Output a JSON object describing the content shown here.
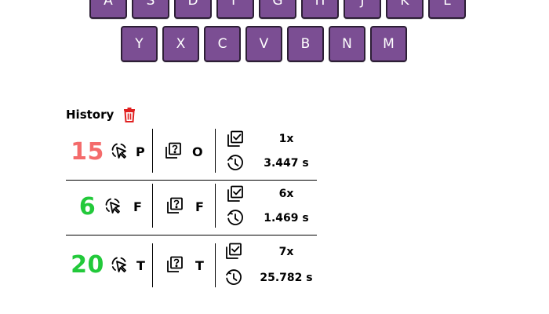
{
  "keyboard": {
    "row2": [
      "A",
      "S",
      "D",
      "F",
      "G",
      "H",
      "J",
      "K",
      "L"
    ],
    "row3": [
      "Y",
      "X",
      "C",
      "V",
      "B",
      "N",
      "M"
    ],
    "key_color": "#7b4e93"
  },
  "history": {
    "title": "History",
    "entries": [
      {
        "score": "15",
        "score_color": "#f46b6b",
        "guess": "P",
        "answer": "O",
        "attempts": "1x",
        "time": "3.447 s"
      },
      {
        "score": "6",
        "score_color": "#22c93a",
        "guess": "F",
        "answer": "F",
        "attempts": "6x",
        "time": "1.469 s"
      },
      {
        "score": "20",
        "score_color": "#22c93a",
        "guess": "T",
        "answer": "T",
        "attempts": "7x",
        "time": "25.782 s"
      }
    ]
  },
  "icons": {
    "clear": "trash-icon",
    "guess": "cursor-click-icon",
    "answer": "question-card-icon",
    "attempts": "checkbox-list-icon",
    "time": "clock-icon"
  },
  "colors": {
    "trash": "#e02020",
    "key_border": "#2d1f36"
  }
}
